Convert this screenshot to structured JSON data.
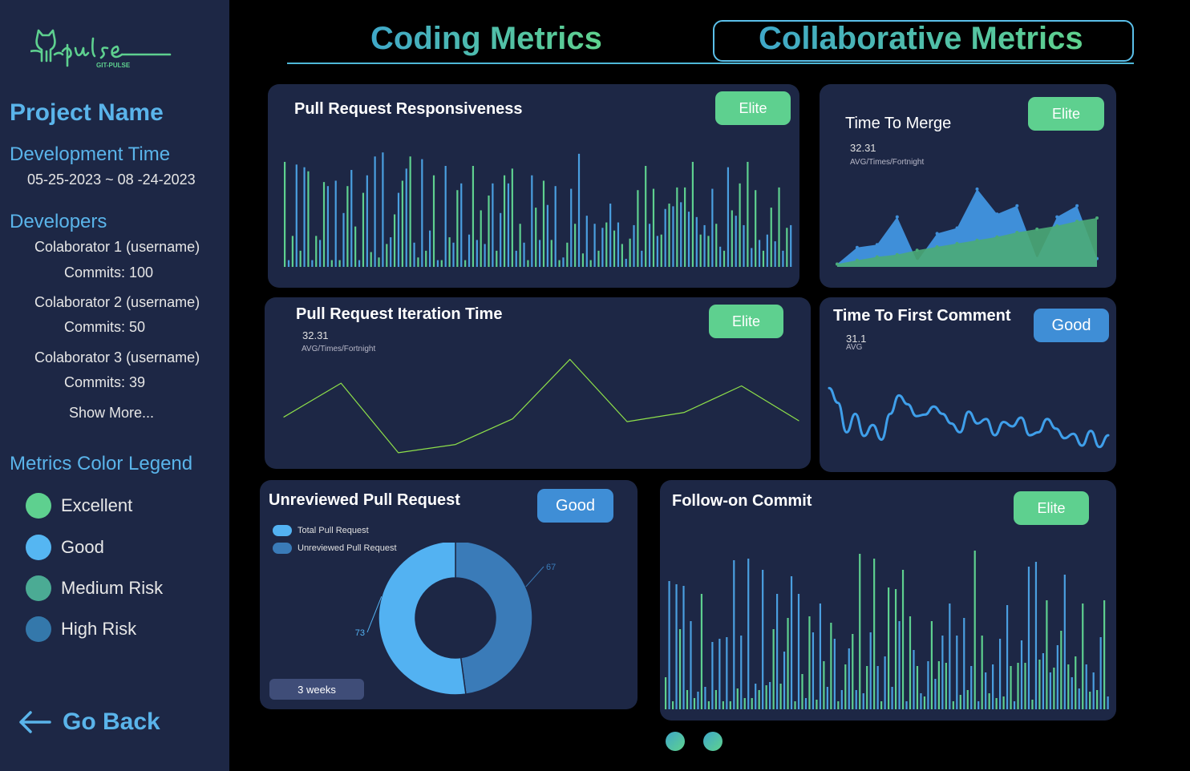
{
  "logo": {
    "text": "pulse",
    "subtext": "GIT-PULSE",
    "icon": "cat-icon"
  },
  "sidebar": {
    "project_name": "Project Name",
    "dev_time_label": "Development Time",
    "dev_time_value": "05-25-2023 ~ 08 -24-2023",
    "developers_label": "Developers",
    "developers": [
      {
        "name": "Colaborator 1 (username)",
        "commits": "Commits: 100"
      },
      {
        "name": "Colaborator 2 (username)",
        "commits": "Commits: 50"
      },
      {
        "name": "Colaborator 3 (username)",
        "commits": "Commits: 39"
      }
    ],
    "show_more": "Show More...",
    "legend_title": "Metrics Color Legend",
    "legend": [
      {
        "label": "Excellent",
        "color": "#5ed08f"
      },
      {
        "label": "Good",
        "color": "#55b6f2"
      },
      {
        "label": "Medium Risk",
        "color": "#4bab94"
      },
      {
        "label": "High Risk",
        "color": "#3478ab"
      }
    ],
    "go_back": "Go Back"
  },
  "tabs": [
    {
      "label": "Coding Metrics",
      "active": false
    },
    {
      "label": "Collaborative Metrics",
      "active": true
    }
  ],
  "cards": {
    "pr_responsiveness": {
      "title": "Pull Request Responsiveness",
      "badge": "Elite"
    },
    "time_to_merge": {
      "title": "Time To Merge",
      "badge": "Elite",
      "value": "32.31",
      "sub": "AVG/Times/Fortnight"
    },
    "pr_iteration": {
      "title": "Pull Request Iteration Time",
      "badge": "Elite",
      "value": "32.31",
      "sub": "AVG/Times/Fortnight"
    },
    "first_comment": {
      "title": "Time To First Comment",
      "badge": "Good",
      "value": "31.1",
      "sub": "AVG"
    },
    "unreviewed": {
      "title": "Unreviewed Pull Request",
      "badge": "Good",
      "legend": [
        "Total  Pull Request",
        "Unreviewed Pull Request"
      ],
      "period": "3 weeks"
    },
    "follow_on": {
      "title": "Follow-on Commit",
      "badge": "Elite"
    }
  },
  "chart_data": [
    {
      "id": "pr-responsiveness",
      "type": "bar",
      "series_colors": [
        "#5ed08f",
        "#4a9fe0"
      ],
      "values": [
        0.78,
        0.05,
        0.23,
        0.76,
        0.12,
        0.74,
        0.71,
        0.05,
        0.23,
        0.2,
        0.63,
        0.6,
        0.05,
        0.64,
        0.05,
        0.4,
        0.6,
        0.72,
        0.3,
        0.05,
        0.55,
        0.68,
        0.11,
        0.82,
        0.07,
        0.85,
        0.17,
        0.22,
        0.39,
        0.55,
        0.64,
        0.73,
        0.82,
        0.18,
        0.07,
        0.8,
        0.12,
        0.27,
        0.68,
        0.05,
        0.05,
        0.75,
        0.22,
        0.18,
        0.57,
        0.62,
        0.05,
        0.24,
        0.75,
        0.2,
        0.42,
        0.17,
        0.53,
        0.62,
        0.12,
        0.4,
        0.68,
        0.62,
        0.73,
        0.12,
        0.32,
        0.18,
        0.05,
        0.68,
        0.44,
        0.2,
        0.64,
        0.46,
        0.2,
        0.6,
        0.05,
        0.07,
        0.18,
        0.58,
        0.32,
        0.84,
        0.1,
        0.38,
        0.05,
        0.32,
        0.12,
        0.29,
        0.33,
        0.47,
        0.27,
        0.33,
        0.17,
        0.06,
        0.21,
        0.31,
        0.57,
        0.12,
        0.75,
        0.32,
        0.58,
        0.23,
        0.24,
        0.43,
        0.47,
        0.45,
        0.59,
        0.48,
        0.59,
        0.41,
        0.78,
        0.37,
        0.24,
        0.31,
        0.23,
        0.58,
        0.32,
        0.15,
        0.12,
        0.74,
        0.42,
        0.38,
        0.62,
        0.31,
        0.78,
        0.14,
        0.57,
        0.2,
        0.12,
        0.24,
        0.44,
        0.19,
        0.59,
        0.12,
        0.29,
        0.31
      ]
    },
    {
      "id": "time-to-merge",
      "type": "area",
      "series": [
        {
          "name": "",
          "color": "#3f8fd9",
          "values": [
            5,
            35,
            40,
            90,
            10,
            60,
            70,
            140,
            95,
            110,
            15,
            90,
            110,
            15
          ]
        },
        {
          "name": "",
          "color": "#4bab77",
          "values": [
            5,
            12,
            18,
            22,
            30,
            36,
            42,
            48,
            54,
            62,
            68,
            74,
            82,
            88
          ]
        }
      ],
      "ylim": [
        0,
        150
      ]
    },
    {
      "id": "pr-iteration",
      "type": "line",
      "color": "#8ee04a",
      "values": [
        47,
        84,
        8,
        17,
        45,
        110,
        42,
        52,
        81,
        43
      ],
      "ylim": [
        0,
        120
      ]
    },
    {
      "id": "first-comment",
      "type": "line",
      "color": "#3f9fea",
      "values": [
        90,
        70,
        30,
        55,
        25,
        40,
        20,
        55,
        80,
        68,
        52,
        54,
        65,
        55,
        42,
        30,
        58,
        42,
        48,
        26,
        44,
        38,
        50,
        26,
        30,
        48,
        35,
        22,
        28,
        12,
        32,
        10,
        26
      ],
      "ylim": [
        0,
        100
      ]
    },
    {
      "id": "unreviewed",
      "type": "pie",
      "labels": [
        "Total  Pull Request",
        "Unreviewed Pull Request"
      ],
      "values": [
        73,
        67
      ],
      "colors": [
        "#53b2f2",
        "#3a7bb8"
      ]
    },
    {
      "id": "follow-on",
      "type": "bar",
      "series_colors": [
        "#5ed08f",
        "#4a9fe0"
      ],
      "values": [
        0.2,
        0.8,
        0.05,
        0.78,
        0.5,
        0.77,
        0.12,
        0.55,
        0.07,
        0.11,
        0.72,
        0.14,
        0.05,
        0.42,
        0.12,
        0.44,
        0.05,
        0.45,
        0.05,
        0.93,
        0.13,
        0.46,
        0.07,
        0.94,
        0.07,
        0.16,
        0.12,
        0.87,
        0.15,
        0.17,
        0.5,
        0.72,
        0.16,
        0.36,
        0.57,
        0.83,
        0.05,
        0.72,
        0.22,
        0.07,
        0.58,
        0.48,
        0.06,
        0.66,
        0.3,
        0.14,
        0.54,
        0.44,
        0.05,
        0.12,
        0.28,
        0.38,
        0.47,
        0.12,
        0.97,
        0.1,
        0.27,
        0.48,
        0.94,
        0.27,
        0.05,
        0.33,
        0.76,
        0.14,
        0.75,
        0.55,
        0.87,
        0.05,
        0.58,
        0.37,
        0.27,
        0.1,
        0.08,
        0.3,
        0.55,
        0.19,
        0.3,
        0.46,
        0.29,
        0.66,
        0.05,
        0.46,
        0.09,
        0.57,
        0.12,
        0.27,
        0.99,
        0.05,
        0.46,
        0.23,
        0.1,
        0.28,
        0.07,
        0.44,
        0.08,
        0.65,
        0.27,
        0.05,
        0.29,
        0.43,
        0.29,
        0.89,
        0.06,
        0.92,
        0.31,
        0.35,
        0.68,
        0.23,
        0.26,
        0.4,
        0.49,
        0.84,
        0.28,
        0.2,
        0.33,
        0.13,
        0.66,
        0.28,
        0.11,
        0.23,
        0.12,
        0.45,
        0.68,
        0.08
      ]
    }
  ]
}
